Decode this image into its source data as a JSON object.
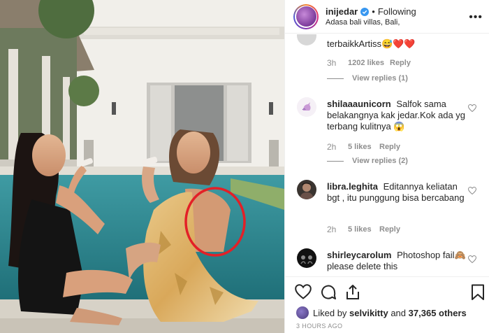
{
  "post": {
    "username": "inijedar",
    "follow_status": "Following",
    "location": "Adasa bali villas, Bali,"
  },
  "comments": [
    {
      "username": "",
      "text": "terbaikkArtiss😅❤️❤️",
      "time": "3h",
      "likes": "1202 likes",
      "reply": "Reply",
      "view_replies": "View replies (1)"
    },
    {
      "username": "shilaaaunicorn",
      "text": "Salfok sama belakangnya kak jedar.Kok ada yg terbang kulitnya 😱",
      "time": "2h",
      "likes": "5 likes",
      "reply": "Reply",
      "view_replies": "View replies (2)"
    },
    {
      "username": "libra.leghita",
      "text": "Editannya keliatan bgt , itu punggung bisa bercabang",
      "time": "2h",
      "likes": "5 likes",
      "reply": "Reply"
    },
    {
      "username": "shirleycarolum",
      "text": "Photoshop fail🙈 please delete this"
    }
  ],
  "footer": {
    "liked_by_prefix": "Liked by",
    "liked_by_user": "selvikitty",
    "liked_by_joiner": "and",
    "liked_by_count": "37,365 others",
    "timestamp": "3 HOURS AGO"
  },
  "icons": {
    "more": "more-options-icon",
    "like": "heart-icon",
    "comment": "comment-icon",
    "share": "share-icon",
    "save": "bookmark-icon"
  },
  "colors": {
    "verified": "#3897f0",
    "annotation_circle": "#e32027",
    "pool": "#2f8a93"
  }
}
